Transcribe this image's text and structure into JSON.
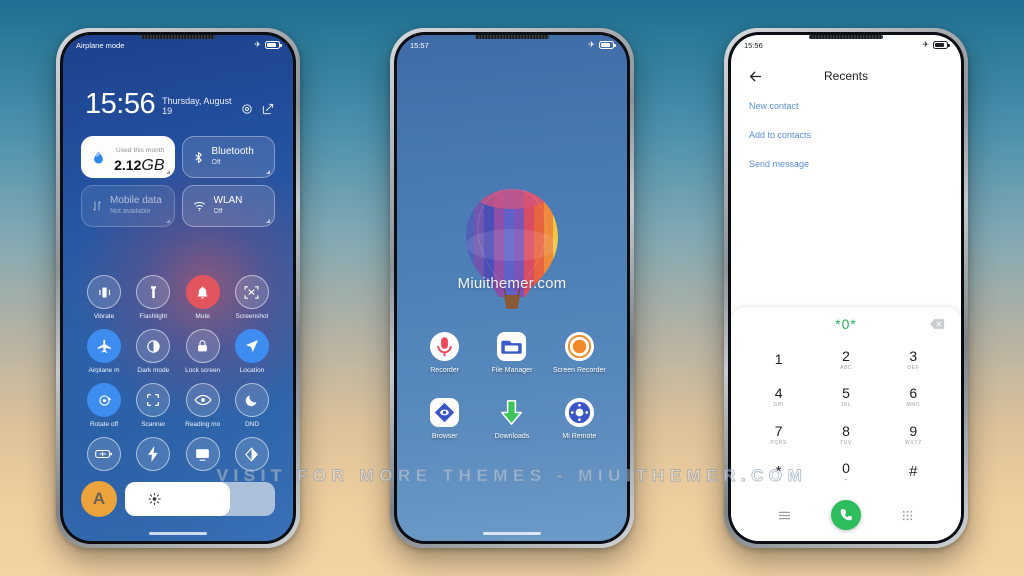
{
  "background": {
    "top_color": "#1f6f92",
    "bottom_color": "#f3d3a4"
  },
  "watermark": {
    "text": "VISIT  FOR  MORE  THEMES  -  MIUITHEMER.COM"
  },
  "phone_left": {
    "status_bar": {
      "label": "Airplane mode",
      "airplane_icon": "airplane-icon",
      "battery_icon": "battery-icon"
    },
    "clock": {
      "time": "15:56",
      "date": "Thursday, August 19"
    },
    "header_icons": {
      "settings": "gear-icon",
      "edit": "edit-icon"
    },
    "tiles_row1": [
      {
        "name": "data-usage",
        "label": "Used this month",
        "value": "2.12",
        "unit": "GB",
        "icon": "water-drop-icon",
        "style": "light"
      },
      {
        "name": "bluetooth",
        "label": "Bluetooth",
        "sub": "Off",
        "icon": "bluetooth-icon",
        "style": "translucent"
      }
    ],
    "tiles_row2": [
      {
        "name": "mobile-data",
        "label": "Mobile data",
        "sub": "Not available",
        "icon": "data-transfer-icon",
        "style": "dim"
      },
      {
        "name": "wlan",
        "label": "WLAN",
        "sub": "Off",
        "icon": "wifi-icon",
        "style": "translucent"
      }
    ],
    "toggles": [
      {
        "label": "Vibrate",
        "icon": "vibrate-icon",
        "state": "off"
      },
      {
        "label": "Flashlight",
        "icon": "flashlight-icon",
        "state": "off"
      },
      {
        "label": "Mute",
        "icon": "bell-icon",
        "state": "red"
      },
      {
        "label": "Screenshot",
        "icon": "screenshot-icon",
        "state": "off"
      },
      {
        "label": "Airplane m",
        "icon": "airplane-icon",
        "state": "on"
      },
      {
        "label": "Dark mode",
        "icon": "contrast-icon",
        "state": "off"
      },
      {
        "label": "Lock screen",
        "icon": "lock-icon",
        "state": "off"
      },
      {
        "label": "Location",
        "icon": "location-arrow-icon",
        "state": "on"
      },
      {
        "label": "Rotate off",
        "icon": "rotate-lock-icon",
        "state": "on"
      },
      {
        "label": "Scanner",
        "icon": "scan-frame-icon",
        "state": "off"
      },
      {
        "label": "Reading mo",
        "icon": "eye-icon",
        "state": "off"
      },
      {
        "label": "DND",
        "icon": "moon-icon",
        "state": "off"
      },
      {
        "label": "",
        "icon": "battery-saver-icon",
        "state": "off"
      },
      {
        "label": "",
        "icon": "lightning-icon",
        "state": "off"
      },
      {
        "label": "",
        "icon": "cast-screen-icon",
        "state": "off"
      },
      {
        "label": "",
        "icon": "color-mode-icon",
        "state": "off"
      }
    ],
    "brightness": {
      "auto_label": "A",
      "icon": "sun-icon",
      "level_percent": 70
    }
  },
  "phone_center": {
    "status_bar": {
      "time": "15:57",
      "airplane_icon": "airplane-icon",
      "battery_icon": "battery-icon"
    },
    "wallpaper_watermark": "Miuithemer.com",
    "wallpaper_subject": "hot-air-balloon",
    "apps_row1": [
      {
        "label": "Recorder",
        "icon": "microphone-icon"
      },
      {
        "label": "File Manager",
        "icon": "folder-icon"
      },
      {
        "label": "Screen Recorder",
        "icon": "record-circle-icon"
      }
    ],
    "apps_row2": [
      {
        "label": "Browser",
        "icon": "browser-compass-icon"
      },
      {
        "label": "Downloads",
        "icon": "download-arrow-icon"
      },
      {
        "label": "Mi Remote",
        "icon": "remote-control-icon"
      }
    ]
  },
  "phone_right": {
    "status_bar": {
      "time": "15:56",
      "airplane_icon": "airplane-icon",
      "battery_icon": "battery-icon"
    },
    "app_bar": {
      "back_icon": "back-arrow-icon",
      "title": "Recents"
    },
    "links": [
      "New contact",
      "Add to contacts",
      "Send message"
    ],
    "dialer": {
      "number": "*0*",
      "backspace_icon": "backspace-icon",
      "keys": [
        {
          "digit": "1",
          "letters": ""
        },
        {
          "digit": "2",
          "letters": "ABC"
        },
        {
          "digit": "3",
          "letters": "DEF"
        },
        {
          "digit": "4",
          "letters": "GHI"
        },
        {
          "digit": "5",
          "letters": "JKL"
        },
        {
          "digit": "6",
          "letters": "MNO"
        },
        {
          "digit": "7",
          "letters": "PQRS"
        },
        {
          "digit": "8",
          "letters": "TUV"
        },
        {
          "digit": "9",
          "letters": "WXYZ"
        },
        {
          "digit": "*",
          "letters": ""
        },
        {
          "digit": "0",
          "letters": "+"
        },
        {
          "digit": "#",
          "letters": ""
        }
      ],
      "bottom": {
        "menu_icon": "hamburger-menu-icon",
        "call_icon": "phone-handset-icon",
        "keypad_icon": "keypad-grid-icon"
      },
      "call_button_color": "#2ebd5c",
      "number_color": "#27ae5f"
    }
  }
}
